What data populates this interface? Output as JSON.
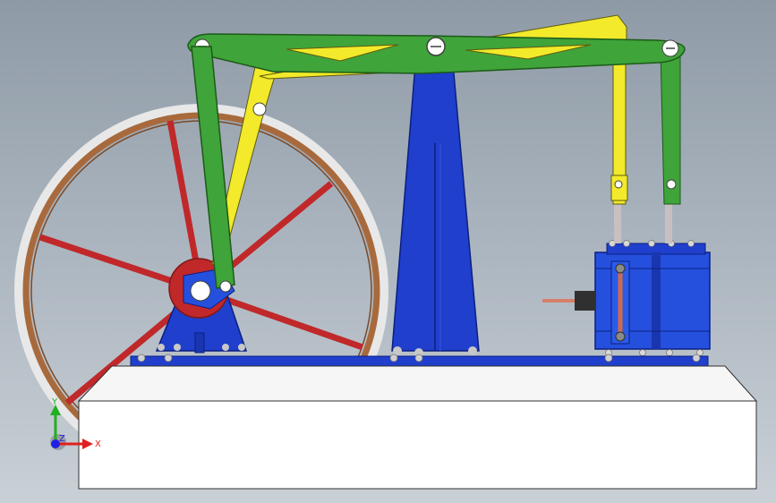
{
  "viewport": {
    "colors": {
      "background_top": "#8e9aa6",
      "background_bottom": "#c9d0d6",
      "beam": "#3fa43a",
      "link_yellow": "#f2ea2a",
      "column_blue": "#1f3fcc",
      "flywheel_rim": "#a86a3c",
      "flywheel_spokes": "#c0282a",
      "base_block": "#ffffff"
    }
  },
  "triad": {
    "x_label": "X",
    "y_label": "Y",
    "z_label": "Z",
    "x_color": "#e02020",
    "y_color": "#20b020",
    "z_color": "#2020e0"
  }
}
